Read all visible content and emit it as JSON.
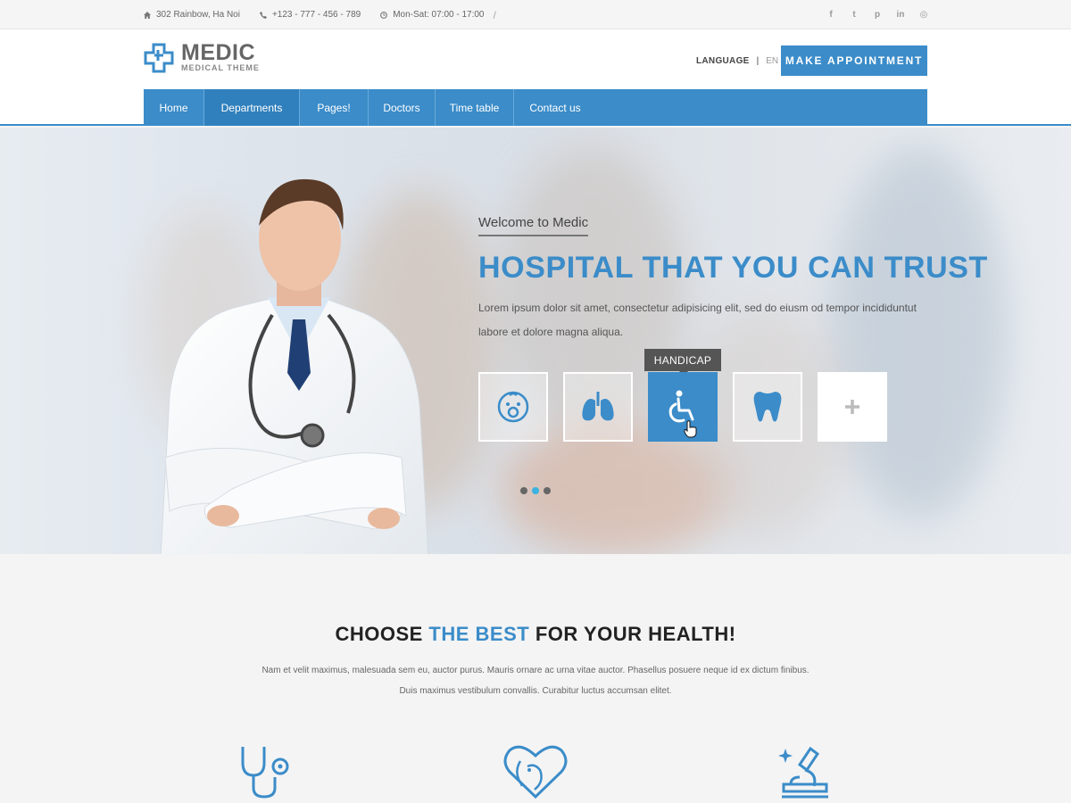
{
  "topbar": {
    "address": "302  Rainbow, Ha Noi",
    "phone": "+123 - 777 - 456 - 789",
    "hours": "Mon-Sat: 07:00 - 17:00",
    "separator": "/",
    "social": [
      {
        "icon": "facebook-icon",
        "glyph": "f"
      },
      {
        "icon": "twitter-icon",
        "glyph": "t"
      },
      {
        "icon": "pinterest-icon",
        "glyph": "p"
      },
      {
        "icon": "linkedin-icon",
        "glyph": "in"
      },
      {
        "icon": "dribbble-icon",
        "glyph": "◎"
      }
    ]
  },
  "header": {
    "logo_name": "MEDIC",
    "logo_sub": "MEDICAL THEME",
    "language_label": "LANGUAGE",
    "language_sep": "|",
    "language_code": "EN",
    "appointment_label": "MAKE APPOINTMENT"
  },
  "nav": {
    "items": [
      {
        "label": "Home"
      },
      {
        "label": "Departments"
      },
      {
        "label": "Pages!"
      },
      {
        "label": "Doctors"
      },
      {
        "label": "Time table"
      },
      {
        "label": "Contact us"
      }
    ],
    "active_index": 1
  },
  "hero": {
    "welcome": "Welcome to Medic",
    "title": "HOSPITAL THAT YOU CAN TRUST",
    "description": "Lorem ipsum dolor sit amet, consectetur adipisicing elit, sed do eiusm od tempor incididuntut labore et dolore magna aliqua.",
    "departments": [
      {
        "icon": "baby-icon"
      },
      {
        "icon": "lungs-icon"
      },
      {
        "icon": "wheelchair-icon"
      },
      {
        "icon": "tooth-icon"
      },
      {
        "icon": "plus-icon"
      }
    ],
    "active_department": 2,
    "tooltip": "HANDICAP",
    "slides": 3,
    "active_slide": 1
  },
  "choose": {
    "title_before": "CHOOSE ",
    "title_highlight": "THE BEST",
    "title_after": " FOR YOUR HEALTH!",
    "desc_line1": "Nam et velit maximus, malesuada sem eu, auctor purus. Mauris ornare ac urna vitae auctor. Phasellus posuere neque id ex dictum finibus.",
    "desc_line2": "Duis maximus vestibulum convallis. Curabitur luctus accumsan elitet.",
    "features": [
      {
        "icon": "stethoscope-icon"
      },
      {
        "icon": "heart-elephant-icon"
      },
      {
        "icon": "microscope-icon"
      }
    ]
  },
  "colors": {
    "accent": "#3b8cc9",
    "tooltip": "#555555",
    "dot_active": "#3bb2e0"
  }
}
